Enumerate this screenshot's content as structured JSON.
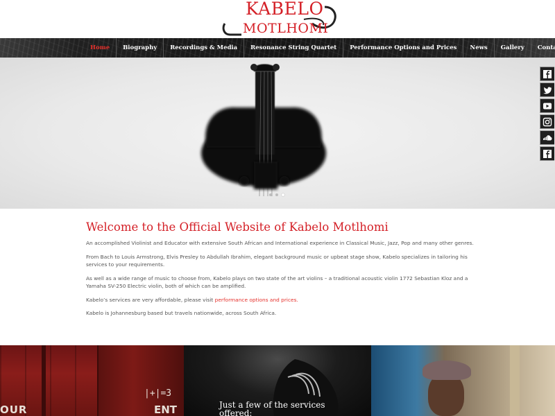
{
  "logo": {
    "line1": "KABELO",
    "line2": "MOTLHOMI"
  },
  "nav": {
    "items": [
      {
        "label": "Home",
        "active": true
      },
      {
        "label": "Biography",
        "active": false
      },
      {
        "label": "Recordings & Media",
        "active": false
      },
      {
        "label": "Resonance String Quartet",
        "active": false
      },
      {
        "label": "Performance Options and Prices",
        "active": false
      },
      {
        "label": "News",
        "active": false
      },
      {
        "label": "Gallery",
        "active": false
      },
      {
        "label": "Contact us",
        "active": false
      }
    ]
  },
  "slider": {
    "slide_count": 3,
    "active_slide": 2
  },
  "social": [
    "facebook-icon",
    "twitter-icon",
    "youtube-icon",
    "instagram-icon",
    "soundcloud-icon",
    "facebook-icon"
  ],
  "content": {
    "title": "Welcome to the Official Website of Kabelo Motlhomi",
    "p1": "An accomplished Violinist and Educator with extensive South African and International experience in Classical Music, Jazz, Pop and many other genres.",
    "p2": "From Bach to Louis Armstrong, Elvis Presley to Abdullah Ibrahim, elegant background music or upbeat stage show, Kabelo specializes in tailoring his services to your requirements.",
    "p3": "As well as a wide range of music to choose from, Kabelo plays on two state of the art violins – a traditional acoustic violin 1772 Sebastian Kloz and a Yamaha SV-250 Electric violin, both of which can be amplified.",
    "p4_prefix": "Kabelo’s services are very affordable, please visit ",
    "p4_link": "performance options and prices.",
    "p5": "Kabelo is Johannesburg based but travels nationwide, across South Africa."
  },
  "panels": {
    "chalk1": "|+|=3",
    "chalk2": "OUR",
    "chalk3": "ENT",
    "services_heading": "Just a few of the services offered:"
  },
  "colors": {
    "accent": "#d41f26",
    "nav_bg": "#1a1a1a",
    "body_text": "#555555"
  }
}
